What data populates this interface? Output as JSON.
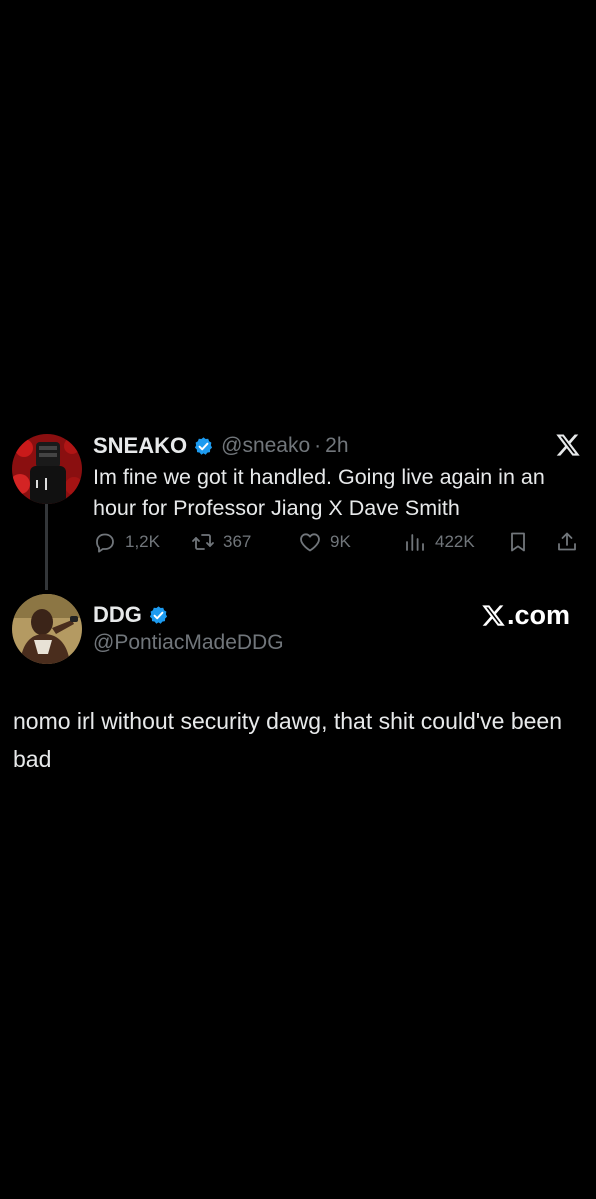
{
  "colors": {
    "background": "#000000",
    "primary_text": "#e7e9ea",
    "secondary_text": "#71767b",
    "verified_blue": "#1d9bf0",
    "thread_line": "#333639"
  },
  "quoted_post": {
    "author_name": "SNEAKO",
    "verified": true,
    "handle": "@sneako",
    "separator": "·",
    "time": "2h",
    "text": "Im fine we got it handled. Going live again in an hour for Professor Jiang X Dave Smith",
    "actions": {
      "replies": "1,2K",
      "reposts": "367",
      "likes": "9K",
      "views": "422K"
    },
    "icons": [
      "reply-icon",
      "repost-icon",
      "like-icon",
      "views-icon",
      "bookmark-icon",
      "share-icon",
      "x-logo-icon"
    ]
  },
  "reply_post": {
    "author_name": "DDG",
    "verified": true,
    "handle": "@PontiacMadeDDG",
    "watermark": ".com",
    "text": "nomo irl without security dawg, that shit could've been bad"
  }
}
